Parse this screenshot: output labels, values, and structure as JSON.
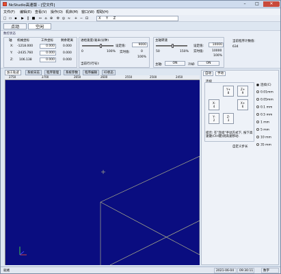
{
  "window": {
    "title": "NcStudio高速版 - [空文件]",
    "min": "–",
    "max": "□",
    "close": "✕"
  },
  "menu": [
    "文件(F)",
    "编辑(E)",
    "查看(V)",
    "操作(O)",
    "机床(M)",
    "窗口(W)",
    "帮助(H)"
  ],
  "toolbar": {
    "coords": [
      "X",
      "Y",
      "Z"
    ]
  },
  "modes": {
    "jog": "点动",
    "idle": "空闲"
  },
  "state": {
    "title": "数控状态",
    "headers": {
      "axis": "轴",
      "machine": "机械坐标",
      "work": "工件坐标",
      "remaining": "剩余距离"
    },
    "rows": [
      {
        "axis": "X:",
        "machine": "-1218.000",
        "work": "0.000",
        "remaining": "0.000"
      },
      {
        "axis": "Y:",
        "machine": "-2435.760",
        "work": "0.000",
        "remaining": "0.000"
      },
      {
        "axis": "Z:",
        "machine": "106.138",
        "work": "0.000",
        "remaining": "0.000"
      }
    ],
    "feed": {
      "title": "进给速度(毫米/分钟)",
      "set_label": "设定值:",
      "set_value": "9000",
      "actual_label": "实时值:",
      "actual_value": "0",
      "percent": "100%",
      "min": "0",
      "max": "100%",
      "current_line": "当前行(行号):"
    },
    "spindle": {
      "title": "主轴转速",
      "set_label": "设定值:",
      "set_value": "10000",
      "actual_label": "实时值:",
      "actual_value": "10000",
      "percent": "100%",
      "min": "50",
      "max": "150%",
      "spindle_label": "主轴:",
      "spindle_btn": "ON",
      "cool_label": "冷却:",
      "cool_btn": "ON"
    },
    "workcount": {
      "label": "当前程序计数值:",
      "value": "634"
    }
  },
  "viewtabs": [
    "加工轨迹",
    "系统日志",
    "程序管理",
    "系统参数",
    "程序编辑",
    "IO状态"
  ],
  "ruler": [
    "2750",
    "2700",
    "2650",
    "2600",
    "2550",
    "2500",
    "2450"
  ],
  "side": {
    "tabs": [
      "自动",
      "手动"
    ],
    "group": "连续",
    "buttons": [
      {
        "label": "Y+",
        "key": "8"
      },
      {
        "label": "Z+",
        "key": "9"
      },
      {
        "label": "X-",
        "key": "4"
      },
      {
        "label": "X+",
        "key": "6"
      },
      {
        "label": "Y-",
        "key": "2"
      },
      {
        "label": "Z-",
        "key": "3"
      }
    ],
    "radios": [
      {
        "label": "连续(C)",
        "selected": true
      },
      {
        "label": "0.01mm",
        "selected": false
      },
      {
        "label": "0.05mm",
        "selected": false
      },
      {
        "label": "0.1 mm",
        "selected": false
      },
      {
        "label": "0.5 mm",
        "selected": false
      },
      {
        "label": "1 mm",
        "selected": false
      },
      {
        "label": "5 mm",
        "selected": false
      },
      {
        "label": "10 mm",
        "selected": false
      },
      {
        "label": "35 mm",
        "selected": false
      }
    ],
    "note": "提示: 在\"连续\"手动方式下, 按下高速键(Ctrl键)则高速移动.",
    "custom": "自定义步长"
  },
  "status": {
    "left": "就绪",
    "date": "2021-06-04",
    "time": "09:30:11",
    "mode": "数字"
  }
}
